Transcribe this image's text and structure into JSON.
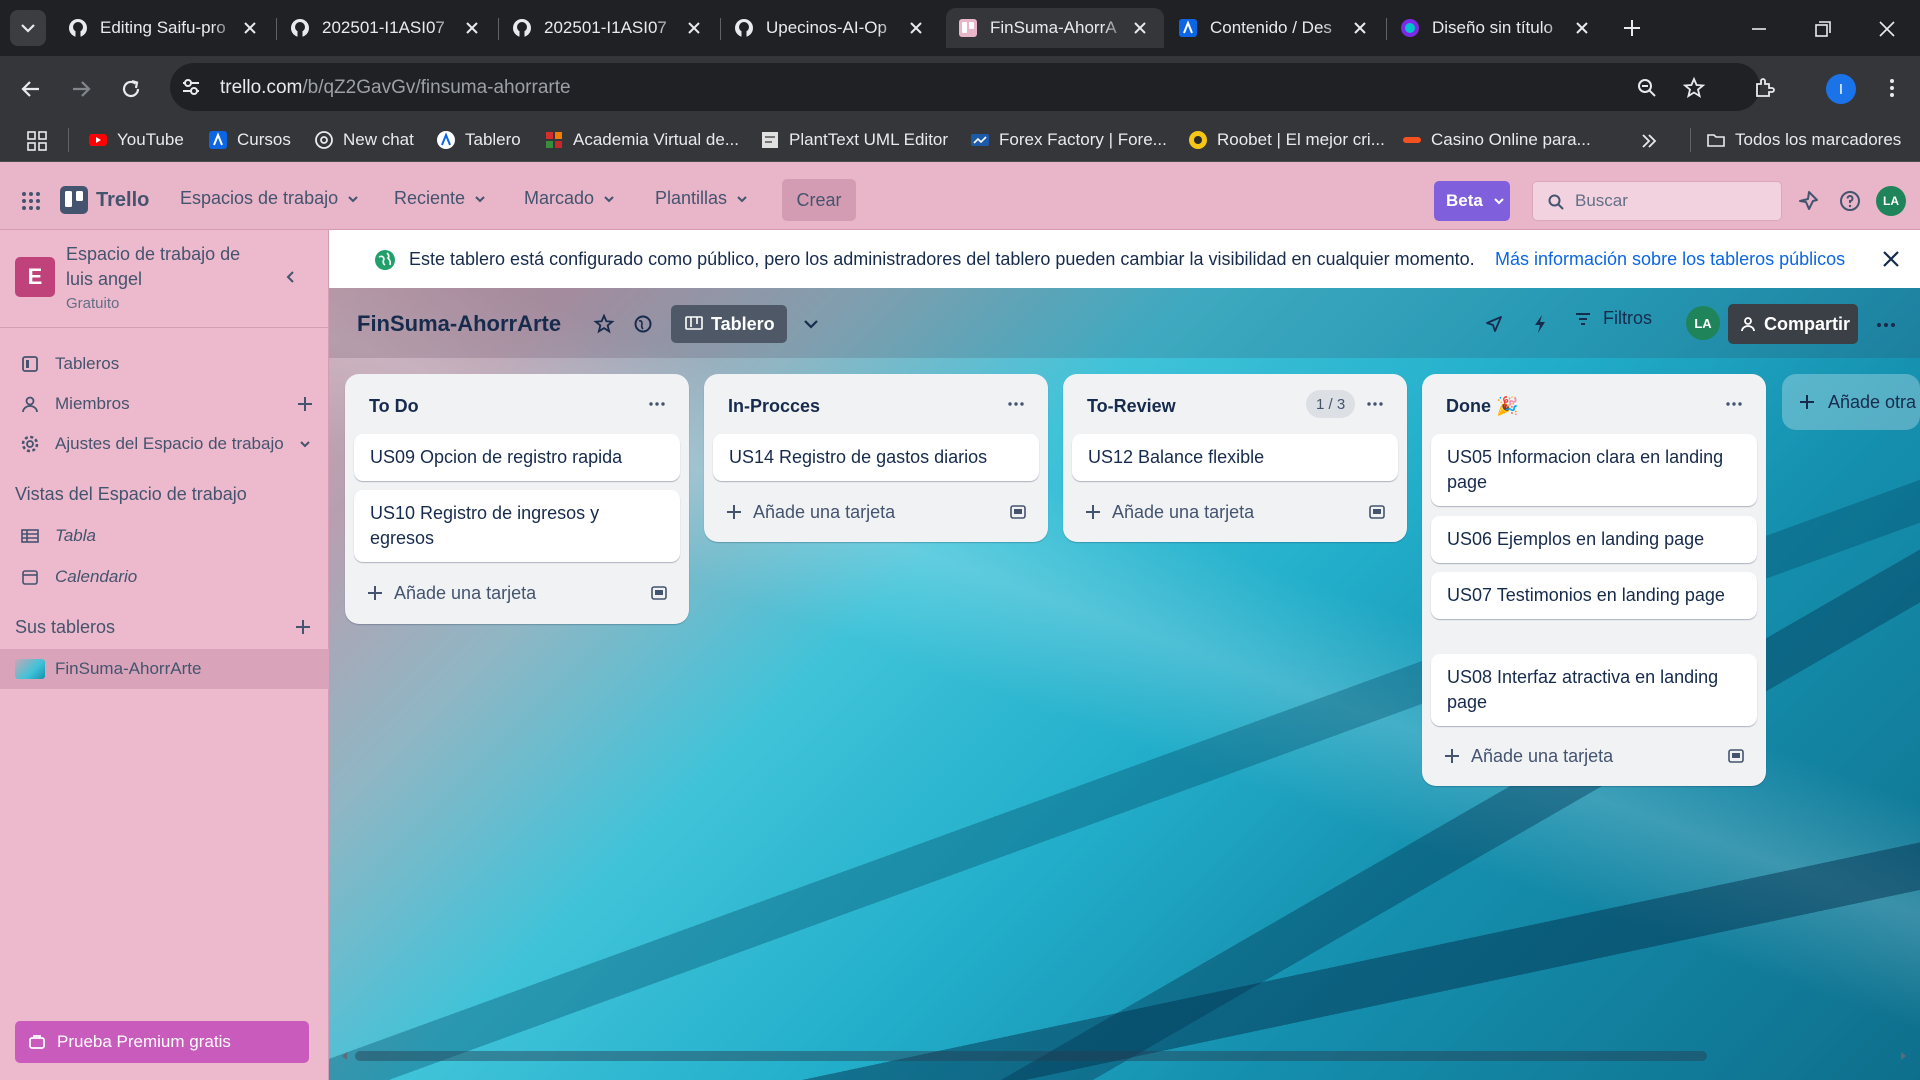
{
  "browser": {
    "tabs": [
      {
        "title": "Editing Saifu-pro",
        "icon": "github-icon"
      },
      {
        "title": "202501-I1ASI07",
        "icon": "github-icon"
      },
      {
        "title": "202501-I1ASI07",
        "icon": "github-icon"
      },
      {
        "title": "Upecinos-AI-Op",
        "icon": "github-icon"
      },
      {
        "title": "FinSuma-AhorrA",
        "icon": "trello-icon",
        "active": true
      },
      {
        "title": "Contenido / Des",
        "icon": "atlassian-icon"
      },
      {
        "title": "Diseño sin título",
        "icon": "canva-icon"
      }
    ],
    "url_host": "trello.com",
    "url_path": "/b/qZ2GavGv/finsuma-ahorrarte",
    "profile_initial": "I",
    "bookmarks": [
      "YouTube",
      "Cursos",
      "New chat",
      "Tablero",
      "Academia Virtual de...",
      "PlantText UML Editor",
      "Forex Factory | Fore...",
      "Roobet | El mejor cri...",
      "Casino Online para..."
    ],
    "all_bookmarks": "Todos los marcadores"
  },
  "header": {
    "logo": "Trello",
    "menus": [
      "Espacios de trabajo",
      "Reciente",
      "Marcado",
      "Plantillas"
    ],
    "create": "Crear",
    "beta": "Beta",
    "search_placeholder": "Buscar",
    "avatar": "LA"
  },
  "sidebar": {
    "workspace_letter": "E",
    "workspace_name_line1": "Espacio de trabajo de",
    "workspace_name_line2": "luis angel",
    "plan": "Gratuito",
    "items": {
      "boards": "Tableros",
      "members": "Miembros",
      "settings": "Ajustes del Espacio de trabajo"
    },
    "views_title": "Vistas del Espacio de trabajo",
    "views": {
      "table": "Tabla",
      "calendar": "Calendario"
    },
    "my_boards_title": "Sus tableros",
    "board": "FinSuma-AhorrArte",
    "premium": "Prueba Premium gratis"
  },
  "banner": {
    "text": "Este tablero está configurado como público, pero los administradores del tablero pueden cambiar la visibilidad en cualquier momento.",
    "link": "Más información sobre los tableros públicos"
  },
  "board": {
    "title": "FinSuma-AhorrArte",
    "view": "Tablero",
    "filters": "Filtros",
    "avatar": "LA",
    "share": "Compartir",
    "add_list": "Añade otra lista",
    "add_card": "Añade una tarjeta",
    "lists": [
      {
        "title": "To Do",
        "cards": [
          "US09 Opcion de registro rapida",
          "US10 Registro de ingresos y egresos"
        ]
      },
      {
        "title": "In-Procces",
        "cards": [
          "US14 Registro de gastos diarios"
        ]
      },
      {
        "title": "To-Review",
        "count": "1 / 3",
        "cards": [
          "US12 Balance flexible"
        ]
      },
      {
        "title": "Done 🎉",
        "cards": [
          "US05 Informacion clara en landing page",
          "US06 Ejemplos en landing page",
          "US07 Testimonios en landing page",
          "US08 Interfaz atractiva en landing page"
        ]
      }
    ]
  },
  "colors": {
    "trello_blue": "#0c66e4",
    "header_pink": "#e8b5c9",
    "beta_purple": "#7f5fdb",
    "share_dark": "#3b3f46"
  }
}
